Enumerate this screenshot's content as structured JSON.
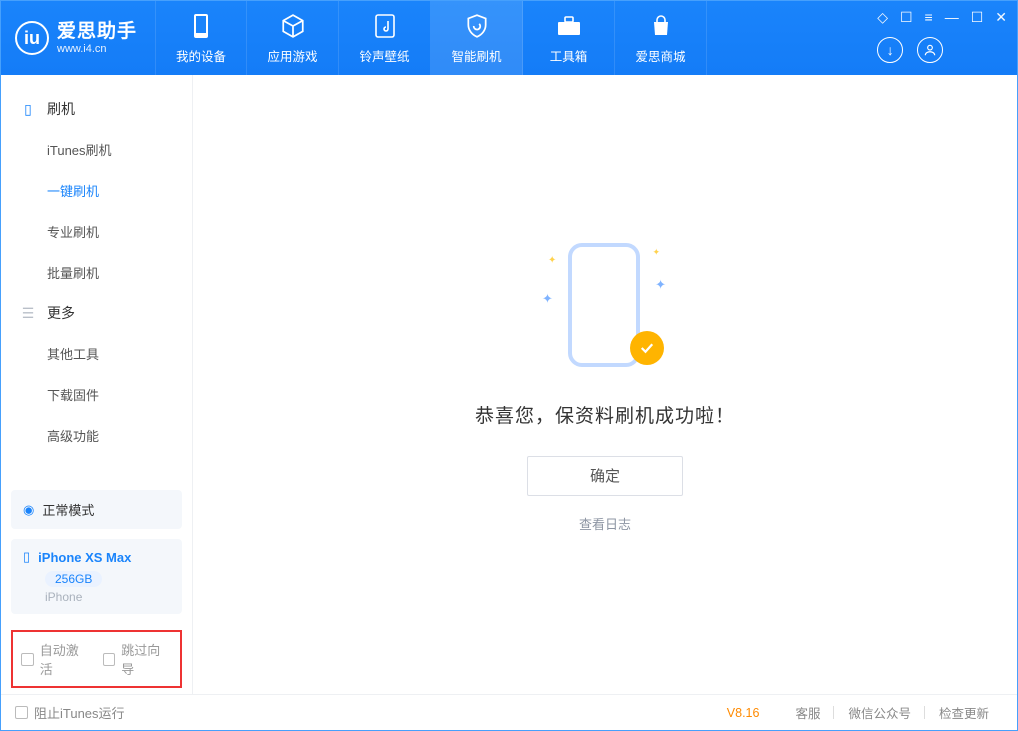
{
  "app": {
    "name_cn": "爱思助手",
    "name_en": "www.i4.cn"
  },
  "nav": {
    "items": [
      {
        "label": "我的设备"
      },
      {
        "label": "应用游戏"
      },
      {
        "label": "铃声壁纸"
      },
      {
        "label": "智能刷机",
        "active": true
      },
      {
        "label": "工具箱"
      },
      {
        "label": "爱思商城"
      }
    ]
  },
  "sidebar": {
    "sec_flash": "刷机",
    "flash_items": [
      {
        "label": "iTunes刷机"
      },
      {
        "label": "一键刷机",
        "active": true
      },
      {
        "label": "专业刷机"
      },
      {
        "label": "批量刷机"
      }
    ],
    "sec_more": "更多",
    "more_items": [
      {
        "label": "其他工具"
      },
      {
        "label": "下载固件"
      },
      {
        "label": "高级功能"
      }
    ],
    "mode": "正常模式",
    "device": {
      "name": "iPhone XS Max",
      "capacity": "256GB",
      "type": "iPhone"
    },
    "auto_activate": "自动激活",
    "skip_wizard": "跳过向导"
  },
  "main": {
    "success": "恭喜您，保资料刷机成功啦！",
    "ok": "确定",
    "view_log": "查看日志"
  },
  "status": {
    "block_itunes": "阻止iTunes运行",
    "version": "V8.16",
    "links": [
      "客服",
      "微信公众号",
      "检查更新"
    ]
  }
}
